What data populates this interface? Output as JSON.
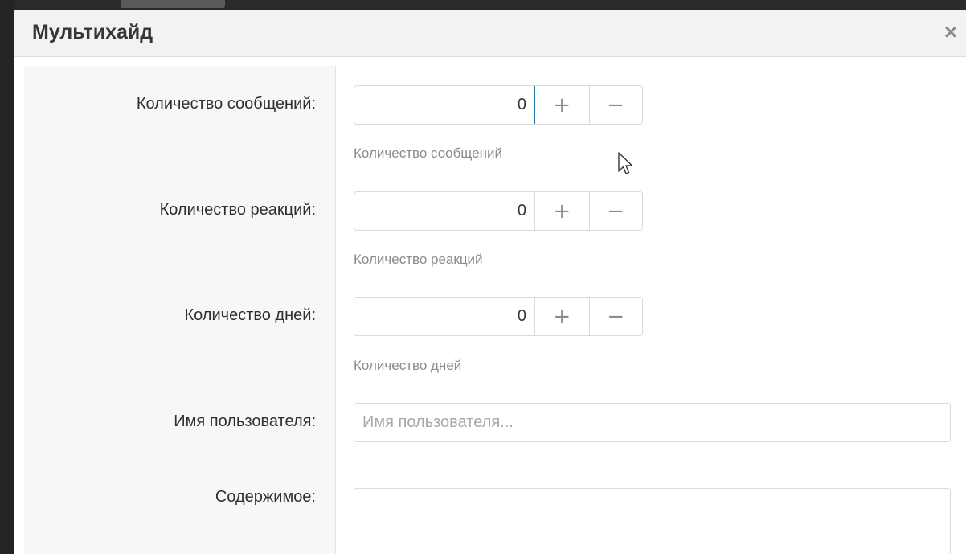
{
  "dialog": {
    "title": "Мультихайд",
    "close_symbol": "×"
  },
  "form": {
    "messages": {
      "label": "Количество сообщений:",
      "value": "0",
      "hint": "Количество сообщений",
      "plus": "+",
      "minus": "−"
    },
    "reactions": {
      "label": "Количество реакций:",
      "value": "0",
      "hint": "Количество реакций",
      "plus": "+",
      "minus": "−"
    },
    "days": {
      "label": "Количество дней:",
      "value": "0",
      "hint": "Количество дней",
      "plus": "+",
      "minus": "−"
    },
    "username": {
      "label": "Имя пользователя:",
      "value": "",
      "placeholder": "Имя пользователя..."
    },
    "content": {
      "label": "Содержимое:",
      "value": ""
    }
  },
  "icons": {
    "close": "close-icon",
    "plus": "plus-icon",
    "minus": "minus-icon",
    "cursor": "mouse-pointer-icon"
  },
  "colors": {
    "header_bg": "#f2f2f2",
    "label_col_bg": "#f7f7f7",
    "focus_accent": "#2577b1",
    "hint_text": "#8c8c8c"
  }
}
